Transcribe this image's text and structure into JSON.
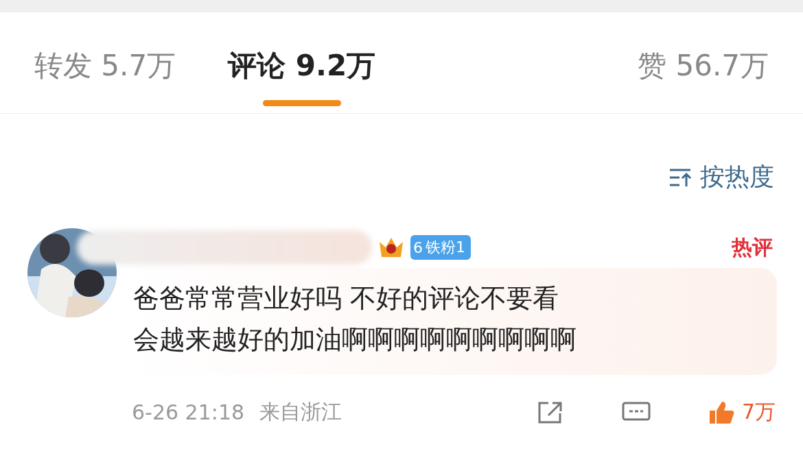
{
  "tabs": [
    {
      "label": "转发 5.7万",
      "selected": false
    },
    {
      "label": "评论 9.2万",
      "selected": true
    },
    {
      "label": "赞 56.7万",
      "selected": false
    }
  ],
  "sort": {
    "label": "按热度"
  },
  "comment": {
    "badge": "铁粉1",
    "badge_level": "6",
    "hot_tag": "热评",
    "text_lines": [
      "爸爸常常营业好吗 不好的评论不要看",
      "会越来越好的加油啊啊啊啊啊啊啊啊啊"
    ],
    "time": "6-26 21:18",
    "location": "来自浙江",
    "likes": "7万"
  }
}
